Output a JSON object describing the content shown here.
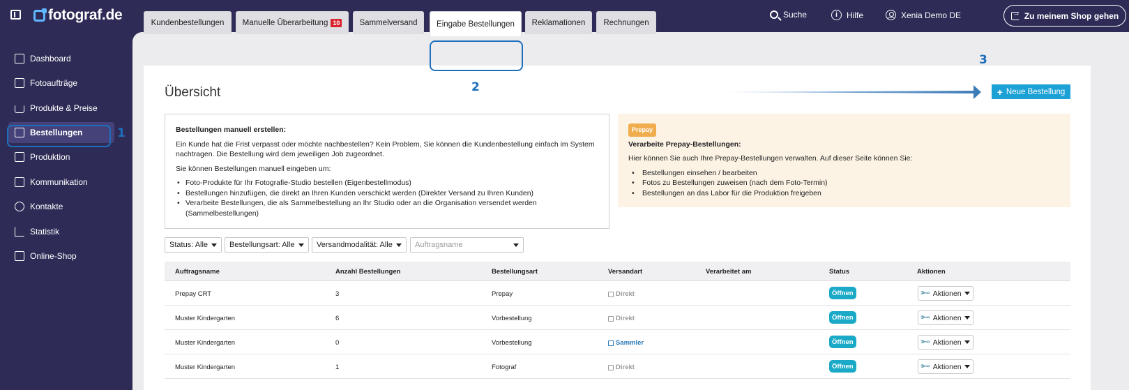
{
  "app": {
    "logo_text": "fotograf.de"
  },
  "topbar": {
    "search_label": "Suche",
    "help_label": "Hilfe",
    "user_label": "Xenia Demo DE",
    "shop_button_label": "Zu meinem Shop gehen"
  },
  "sidebar": {
    "items": [
      {
        "label": "Dashboard",
        "icon": "home-icon"
      },
      {
        "label": "Fotoaufträge",
        "icon": "image-icon"
      },
      {
        "label": "Produkte & Preise",
        "icon": "cart-icon"
      },
      {
        "label": "Bestellungen",
        "icon": "orders-icon",
        "active": true
      },
      {
        "label": "Produktion",
        "icon": "printer-icon"
      },
      {
        "label": "Kommunikation",
        "icon": "chat-icon"
      },
      {
        "label": "Kontakte",
        "icon": "user-icon"
      },
      {
        "label": "Statistik",
        "icon": "chart-icon"
      },
      {
        "label": "Online-Shop",
        "icon": "store-icon"
      }
    ]
  },
  "annotations": {
    "one": "1",
    "two": "2",
    "three": "3",
    "color": "#1e6fbb"
  },
  "tabs": [
    {
      "label": "Kundenbestellungen"
    },
    {
      "label": "Manuelle Überarbeitung",
      "badge": "10"
    },
    {
      "label": "Sammelversand"
    },
    {
      "label": "Eingabe Bestellungen",
      "active": true
    },
    {
      "label": "Reklamationen"
    },
    {
      "label": "Rechnungen"
    }
  ],
  "main": {
    "title": "Übersicht",
    "new_button_label": "Neue Bestellung"
  },
  "info_box": {
    "heading": "Bestellungen manuell erstellen:",
    "text1": "Ein Kunde hat die Frist verpasst oder möchte nachbestellen? Kein Problem, Sie können die Kundenbestellung einfach im System nachtragen. Die Bestellung wird dem jeweiligen Job zugeordnet.",
    "text2": "Sie können Bestellungen manuell eingeben um:",
    "bullets": [
      "Foto-Produkte für Ihr Fotografie-Studio bestellen (Eigenbestellmodus)",
      "Bestellungen hinzufügen, die direkt an Ihren Kunden verschickt werden (Direkter Versand zu Ihren Kunden)",
      "Verarbeite Bestellungen, die als Sammelbestellung an Ihr Studio oder an die Organisation versendet werden (Sammelbestellungen)"
    ]
  },
  "prepay_box": {
    "badge": "Prepay",
    "heading": "Verarbeite Prepay-Bestellungen:",
    "text": "Hier können Sie auch Ihre Prepay-Bestellungen verwalten. Auf dieser Seite können Sie:",
    "bullets": [
      "Bestellungen einsehen / bearbeiten",
      "Fotos zu Bestellungen zuweisen (nach dem Foto-Termin)",
      "Bestellungen an das Labor für die Produktion freigeben"
    ]
  },
  "filters": {
    "status": "Status: Alle",
    "order_type": "Bestellungsart: Alle",
    "shipping": "Versandmodalität: Alle",
    "search_placeholder": "Auftragsname"
  },
  "table": {
    "columns": [
      "Auftragsname",
      "Anzahl Bestellungen",
      "Bestellungsart",
      "Versandart",
      "Verarbeitet am",
      "Status",
      "Aktionen"
    ],
    "rows": [
      {
        "name": "Prepay CRT",
        "count": "3",
        "type": "Prepay",
        "shipping": "Direkt",
        "processed": "",
        "status": "Öffnen",
        "actions": "Aktionen"
      },
      {
        "name": "Muster Kindergarten",
        "count": "6",
        "type": "Vorbestellung",
        "shipping": "Direkt",
        "processed": "",
        "status": "Öffnen",
        "actions": "Aktionen"
      },
      {
        "name": "Muster Kindergarten",
        "count": "0",
        "type": "Vorbestellung",
        "shipping": "Sammler",
        "processed": "",
        "status": "Öffnen",
        "actions": "Aktionen"
      },
      {
        "name": "Muster Kindergarten",
        "count": "1",
        "type": "Fotograf",
        "shipping": "Direkt",
        "processed": "",
        "status": "Öffnen",
        "actions": "Aktionen"
      }
    ]
  }
}
